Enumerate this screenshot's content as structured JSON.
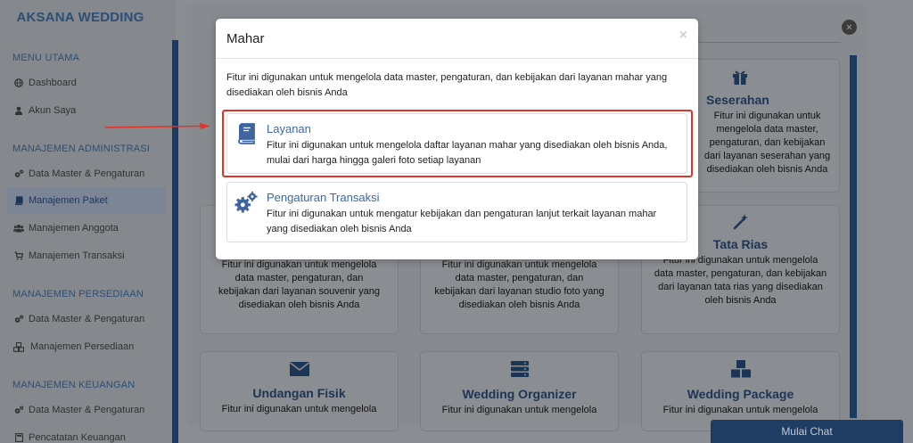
{
  "sidebar": {
    "brand": "AKSANA WEDDING",
    "sections": [
      {
        "title": "MENU UTAMA",
        "items": [
          {
            "label": "Dashboard",
            "icon": "globe-icon"
          },
          {
            "label": "Akun Saya",
            "icon": "user-icon"
          }
        ]
      },
      {
        "title": "MANAJEMEN ADMINISTRASI",
        "items": [
          {
            "label": "Data Master & Pengaturan",
            "icon": "cogs-icon"
          },
          {
            "label": "Manajemen Paket",
            "icon": "book-icon",
            "active": true
          },
          {
            "label": "Manajemen Anggota",
            "icon": "users-icon"
          },
          {
            "label": "Manajemen Transaksi",
            "icon": "cart-icon"
          }
        ]
      },
      {
        "title": "MANAJEMEN PERSEDIAAN",
        "items": [
          {
            "label": "Data Master & Pengaturan",
            "icon": "cogs-icon"
          },
          {
            "label": "Manajemen Persediaan",
            "icon": "cubes-icon"
          }
        ]
      },
      {
        "title": "MANAJEMEN KEUANGAN",
        "items": [
          {
            "label": "Data Master & Pengaturan",
            "icon": "cogs-icon"
          },
          {
            "label": "Pencatatan Keuangan",
            "icon": "calculator-icon"
          }
        ]
      }
    ]
  },
  "background_cards": {
    "seserahan": {
      "title": "Seserahan",
      "desc": "Fitur ini digunakan untuk mengelola data master, pengaturan, dan kebijakan dari layanan seserahan yang disediakan oleh bisnis Anda",
      "icon": "gift-icon"
    },
    "souvenir": {
      "desc": "Fitur ini digunakan untuk mengelola data master, pengaturan, dan kebijakan dari layanan souvenir yang disediakan oleh bisnis Anda"
    },
    "studio_foto": {
      "desc": "Fitur ini digunakan untuk mengelola data master, pengaturan, dan kebijakan dari layanan studio foto yang disediakan oleh bisnis Anda"
    },
    "tata_rias": {
      "title": "Tata Rias",
      "desc": "Fitur ini digunakan untuk mengelola data master, pengaturan, dan kebijakan dari layanan tata rias yang disediakan oleh bisnis Anda",
      "icon": "magic-wand-icon"
    },
    "undangan_fisik": {
      "title": "Undangan Fisik",
      "desc": "Fitur ini digunakan untuk mengelola",
      "icon": "envelope-icon"
    },
    "wedding_organizer": {
      "title": "Wedding Organizer",
      "desc": "Fitur ini digunakan untuk mengelola",
      "icon": "server-icon"
    },
    "wedding_package": {
      "title": "Wedding Package",
      "desc": "Fitur ini digunakan untuk mengelola",
      "icon": "cubes-icon"
    }
  },
  "modal": {
    "title": "Mahar",
    "close": "×",
    "description": "Fitur ini digunakan untuk mengelola data master, pengaturan, dan kebijakan dari layanan mahar yang disediakan oleh bisnis Anda",
    "options": [
      {
        "title": "Layanan",
        "desc": "Fitur ini digunakan untuk mengelola daftar layanan mahar yang disediakan oleh bisnis Anda, mulai dari harga hingga galeri foto setiap layanan",
        "icon": "book-icon"
      },
      {
        "title": "Pengaturan Transaksi",
        "desc": "Fitur ini digunakan untuk mengatur kebijakan dan pengaturan lanjut terkait layanan mahar yang disediakan oleh bisnis Anda",
        "icon": "cogs-icon"
      }
    ]
  },
  "chat": {
    "label": "Mulai Chat"
  },
  "colors": {
    "brand": "#2c4f76",
    "accent": "#3a67a8",
    "highlight": "#e0342b",
    "rail": "#193a63"
  }
}
